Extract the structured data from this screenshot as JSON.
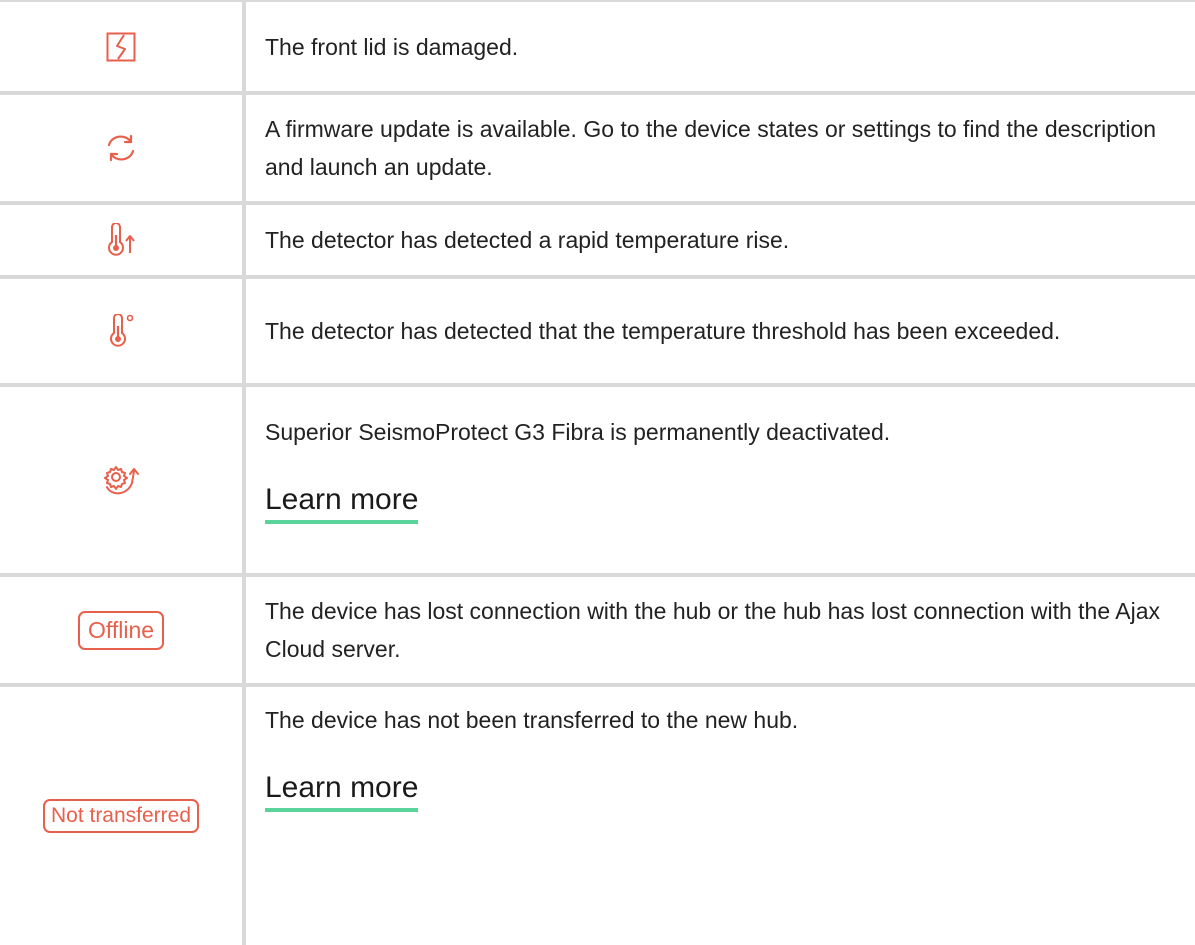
{
  "rows": [
    {
      "icon": "lid-damaged-icon",
      "text": "The front lid is damaged."
    },
    {
      "icon": "firmware-update-icon",
      "text": "A firmware update is available. Go to the device states or settings to find the description and launch an update."
    },
    {
      "icon": "temperature-rise-icon",
      "text": "The detector has detected a rapid temperature rise."
    },
    {
      "icon": "temperature-threshold-icon",
      "text": "The detector has detected that the temperature threshold has been exceeded."
    },
    {
      "icon": "permanently-deactivated-icon",
      "text": "Superior SeismoProtect G3 Fibra is permanently deactivated.",
      "link": "Learn more"
    },
    {
      "badge": "Offline",
      "text": "The device has lost connection with the hub or the hub has lost connection with the Ajax Cloud server."
    },
    {
      "badge": "Not transferred",
      "text": "The device has not been transferred to the new hub.",
      "link": "Learn more"
    }
  ],
  "colors": {
    "accent": "#e8604c",
    "link_underline": "#5bd49b",
    "border": "#d9d9d9"
  }
}
